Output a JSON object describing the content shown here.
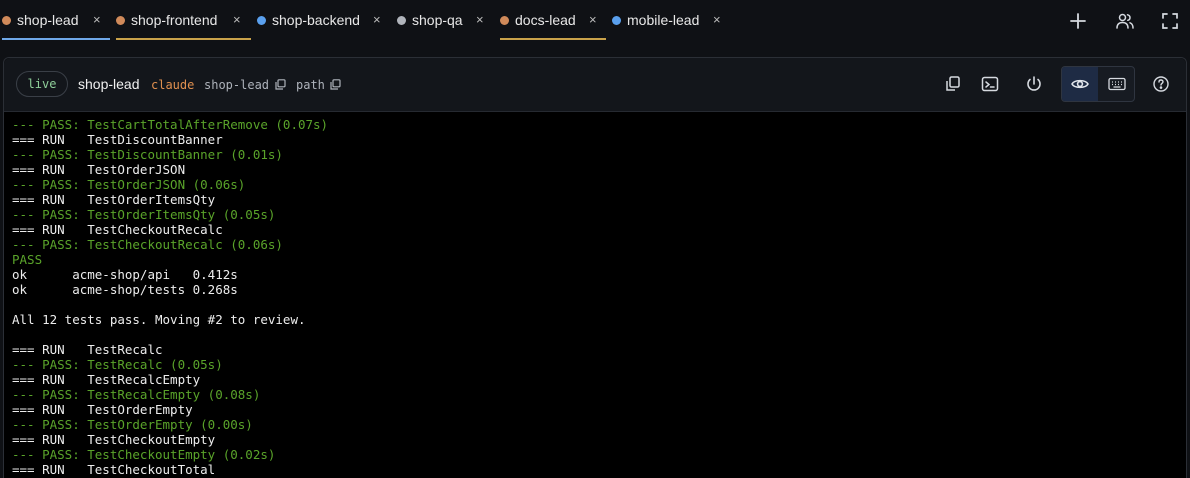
{
  "tabs": [
    {
      "label": "shop-lead",
      "dot_color": "#d08a5a",
      "underline_color": "#6fa8e8",
      "active": true
    },
    {
      "label": "shop-frontend",
      "dot_color": "#d08a5a",
      "underline_color": "#c9a24a",
      "active": false
    },
    {
      "label": "shop-backend",
      "dot_color": "#5aa0ee",
      "underline_color": "",
      "active": false
    },
    {
      "label": "shop-qa",
      "dot_color": "#b0b4bb",
      "underline_color": "",
      "active": false
    },
    {
      "label": "docs-lead",
      "dot_color": "#d08a5a",
      "underline_color": "#c9a24a",
      "active": false
    },
    {
      "label": "mobile-lead",
      "dot_color": "#5aa0ee",
      "underline_color": "",
      "active": false
    }
  ],
  "tab_close_glyph": "×",
  "tabbar_actions": [
    "plus-icon",
    "users-icon",
    "fullscreen-icon"
  ],
  "session": {
    "status": "live",
    "name": "shop-lead",
    "agent": "claude",
    "id_label": "shop-lead",
    "path_label": "path",
    "agent_color": "#e0904f",
    "header_buttons": [
      "copy-icon",
      "terminal-icon",
      "power-icon"
    ],
    "view_toggle": [
      "eye-icon",
      "keyboard-icon"
    ],
    "help_icon": "help-icon"
  },
  "terminal": {
    "lines": [
      {
        "text": "--- PASS: TestCartTotalAfterRemove (0.07s)",
        "kind": "pass"
      },
      {
        "text": "=== RUN   TestDiscountBanner",
        "kind": "plain"
      },
      {
        "text": "--- PASS: TestDiscountBanner (0.01s)",
        "kind": "pass"
      },
      {
        "text": "=== RUN   TestOrderJSON",
        "kind": "plain"
      },
      {
        "text": "--- PASS: TestOrderJSON (0.06s)",
        "kind": "pass"
      },
      {
        "text": "=== RUN   TestOrderItemsQty",
        "kind": "plain"
      },
      {
        "text": "--- PASS: TestOrderItemsQty (0.05s)",
        "kind": "pass"
      },
      {
        "text": "=== RUN   TestCheckoutRecalc",
        "kind": "plain"
      },
      {
        "text": "--- PASS: TestCheckoutRecalc (0.06s)",
        "kind": "pass"
      },
      {
        "text": "PASS",
        "kind": "pass"
      },
      {
        "text": "ok      acme-shop/api   0.412s",
        "kind": "plain"
      },
      {
        "text": "ok      acme-shop/tests 0.268s",
        "kind": "plain"
      },
      {
        "text": "",
        "kind": "plain"
      },
      {
        "text": "All 12 tests pass. Moving #2 to review.",
        "kind": "plain"
      },
      {
        "text": "",
        "kind": "plain"
      },
      {
        "text": "=== RUN   TestRecalc",
        "kind": "plain"
      },
      {
        "text": "--- PASS: TestRecalc (0.05s)",
        "kind": "pass"
      },
      {
        "text": "=== RUN   TestRecalcEmpty",
        "kind": "plain"
      },
      {
        "text": "--- PASS: TestRecalcEmpty (0.08s)",
        "kind": "pass"
      },
      {
        "text": "=== RUN   TestOrderEmpty",
        "kind": "plain"
      },
      {
        "text": "--- PASS: TestOrderEmpty (0.00s)",
        "kind": "pass"
      },
      {
        "text": "=== RUN   TestCheckoutEmpty",
        "kind": "plain"
      },
      {
        "text": "--- PASS: TestCheckoutEmpty (0.02s)",
        "kind": "pass"
      },
      {
        "text": "=== RUN   TestCheckoutTotal",
        "kind": "plain"
      }
    ]
  }
}
